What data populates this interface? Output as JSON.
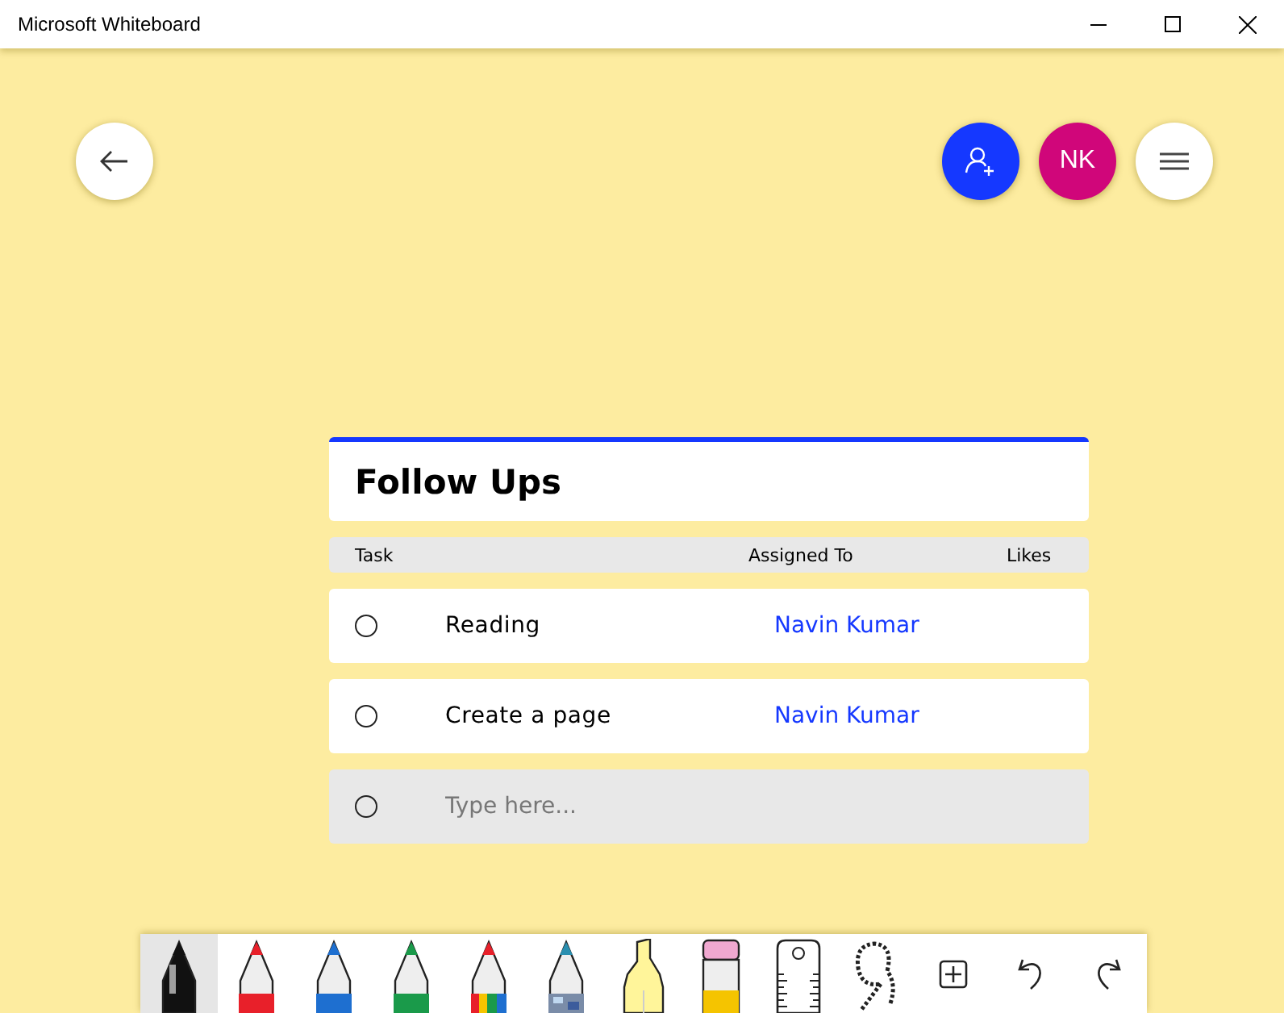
{
  "window": {
    "title": "Microsoft Whiteboard"
  },
  "top_buttons": {
    "avatar_initials": "NK"
  },
  "list": {
    "title": "Follow Ups",
    "columns": [
      "Task",
      "Assigned To",
      "Likes"
    ],
    "rows": [
      {
        "task": "Reading",
        "assignee": "Navin Kumar",
        "checked": false
      },
      {
        "task": "Create a page",
        "assignee": "Navin Kumar",
        "checked": false
      }
    ],
    "new_task": {
      "placeholder": "Type here...",
      "checked": false
    }
  },
  "toolbar": [
    {
      "kind": "pen",
      "color": "#111111",
      "selected": true
    },
    {
      "kind": "pen",
      "color": "#e8202a",
      "selected": false
    },
    {
      "kind": "pen",
      "color": "#1e6fd0",
      "selected": false
    },
    {
      "kind": "pen",
      "color": "#1a9a4a",
      "selected": false
    },
    {
      "kind": "rainbow-pen",
      "selected": false
    },
    {
      "kind": "galaxy-pen",
      "selected": false
    },
    {
      "kind": "highlighter",
      "color": "#fff59a",
      "selected": false
    },
    {
      "kind": "eraser",
      "selected": false
    },
    {
      "kind": "ruler",
      "selected": false
    },
    {
      "kind": "lasso",
      "selected": false
    },
    {
      "kind": "insert",
      "selected": false
    },
    {
      "kind": "undo",
      "selected": false
    },
    {
      "kind": "redo",
      "selected": false
    }
  ]
}
